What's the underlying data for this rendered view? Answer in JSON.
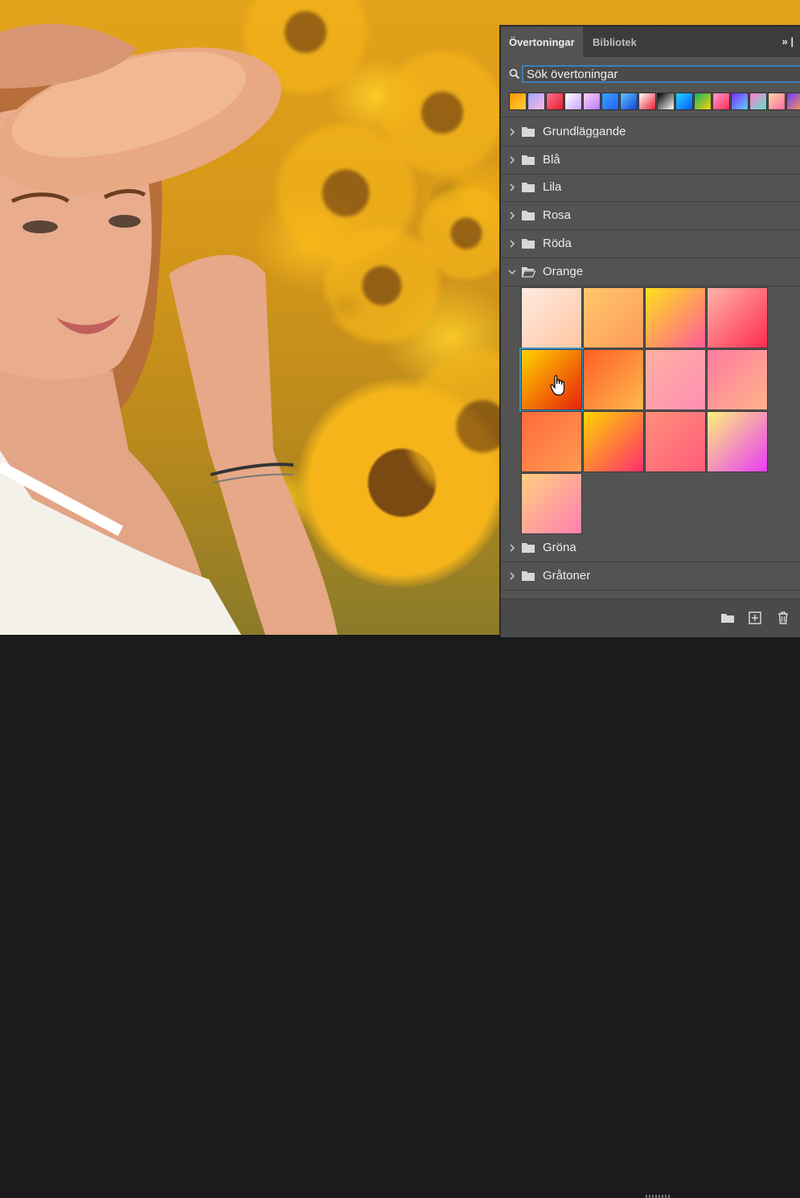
{
  "panel": {
    "tabs": [
      {
        "label": "Övertoningar"
      },
      {
        "label": "Bibliotek"
      }
    ],
    "collapse_icon": "double-chevron-right-icon",
    "search": {
      "value": "Sök övertoningar",
      "icon": "search-icon"
    },
    "recent_swatches": [
      [
        "#ff9500",
        "#ffcf40"
      ],
      [
        "#a0a6ff",
        "#ffb7e2"
      ],
      [
        "#ff6f91",
        "#e8202d"
      ],
      [
        "#ffffff",
        "#c9a4ff"
      ],
      [
        "#ffd1f2",
        "#b37cff"
      ],
      [
        "#33a3ff",
        "#2b5fff"
      ],
      [
        "#5ec6ff",
        "#1842d6"
      ],
      [
        "#ffffff",
        "#e81e2f"
      ],
      [
        "#000000",
        "#ffffff"
      ],
      [
        "#1fd3ff",
        "#0a5cff"
      ],
      [
        "#0fb06b",
        "#ffd200"
      ],
      [
        "#ff9ad0",
        "#ff2d55"
      ],
      [
        "#7b2cff",
        "#5fd0ff"
      ],
      [
        "#ff7bd1",
        "#5fe3c9"
      ],
      [
        "#ffd6a2",
        "#ff6aa8"
      ],
      [
        "#6a3cff",
        "#ff9a4a"
      ]
    ],
    "folders_top": [
      {
        "label": "Grundläggande",
        "open": false
      },
      {
        "label": "Blå",
        "open": false
      },
      {
        "label": "Lila",
        "open": false
      },
      {
        "label": "Rosa",
        "open": false
      },
      {
        "label": "Röda",
        "open": false
      },
      {
        "label": "Orange",
        "open": true
      }
    ],
    "orange_gradients": [
      {
        "colors": [
          "#ffeadf",
          "#ffc6a3"
        ],
        "selected": false
      },
      {
        "colors": [
          "#ffc76a",
          "#ff9a5a"
        ],
        "selected": false
      },
      {
        "colors": [
          "#ffe11a",
          "#ff5c9a"
        ],
        "selected": false
      },
      {
        "colors": [
          "#ffb4a8",
          "#ff2b50"
        ],
        "selected": false
      },
      {
        "colors": [
          "#ffd200",
          "#e8220a"
        ],
        "selected": true
      },
      {
        "colors": [
          "#ff5f27",
          "#ffb84d"
        ],
        "selected": false
      },
      {
        "colors": [
          "#ffb0a0",
          "#ff8fb4"
        ],
        "selected": false
      },
      {
        "colors": [
          "#ff7aa0",
          "#ffb38a"
        ],
        "selected": false
      },
      {
        "colors": [
          "#ff6a3d",
          "#ff9a52"
        ],
        "selected": false
      },
      {
        "colors": [
          "#ffd400",
          "#ff2e6e"
        ],
        "selected": false
      },
      {
        "colors": [
          "#ff8f7a",
          "#ff5c7a"
        ],
        "selected": false
      },
      {
        "colors": [
          "#fff07a",
          "#e83cf5"
        ],
        "selected": false
      },
      {
        "colors": [
          "#ffcf80",
          "#ff7fb0"
        ],
        "selected": false
      }
    ],
    "folders_bottom": [
      {
        "label": "Gröna",
        "open": false
      },
      {
        "label": "Gråtoner",
        "open": false
      }
    ],
    "footer_icons": [
      "new-folder-icon",
      "add-gradient-icon",
      "trash-icon"
    ]
  }
}
